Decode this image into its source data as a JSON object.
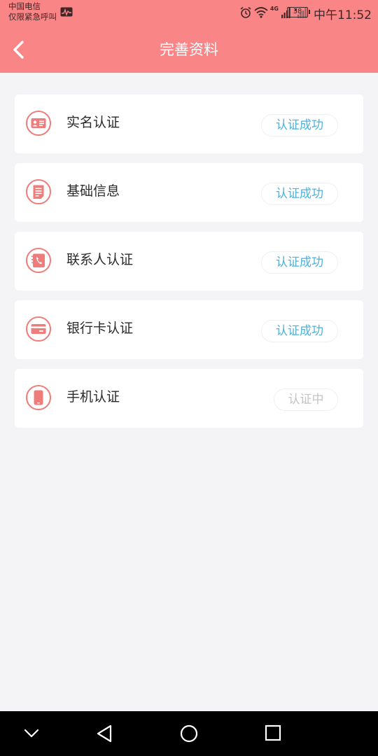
{
  "status_bar": {
    "carrier_line1": "中国电信",
    "carrier_line2": "仅限紧急呼叫",
    "battery": "38",
    "network": "4G",
    "time": "中午11:52",
    "icons": [
      "activity-icon",
      "alarm-icon",
      "wifi-icon",
      "signal-icon",
      "signal-off-icon",
      "battery-icon"
    ]
  },
  "header": {
    "title": "完善资料",
    "back_icon": "chevron-left-icon"
  },
  "items": [
    {
      "label": "实名认证",
      "status": "认证成功",
      "icon": "id-card-icon"
    },
    {
      "label": "基础信息",
      "status": "认证成功",
      "icon": "document-icon"
    },
    {
      "label": "联系人认证",
      "status": "认证成功",
      "icon": "contact-book-icon"
    },
    {
      "label": "银行卡认证",
      "status": "认证成功",
      "icon": "bank-card-icon"
    },
    {
      "label": "手机认证",
      "status": "认证中",
      "icon": "phone-icon"
    }
  ],
  "colors": {
    "accent": "#f98587",
    "success_text": "#4fb0d8",
    "pending_text": "#c4c4c4",
    "background": "#f4f3f6"
  },
  "nav_bar": {
    "icons": [
      "chevron-down-icon",
      "back-triangle-icon",
      "home-circle-icon",
      "recents-square-icon"
    ]
  }
}
